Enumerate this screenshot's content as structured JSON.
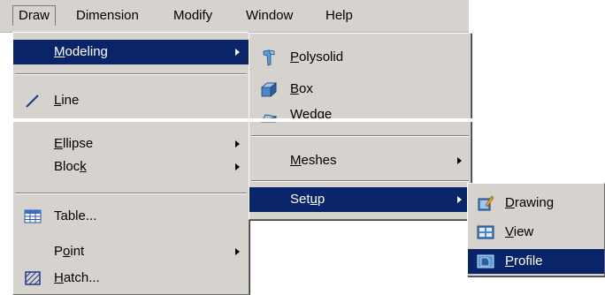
{
  "menubar": {
    "items": [
      "Draw",
      "Dimension",
      "Modify",
      "Window",
      "Help"
    ]
  },
  "draw_menu": {
    "modeling": {
      "pre": "",
      "acc": "M",
      "post": "odeling"
    },
    "line": {
      "pre": "",
      "acc": "L",
      "post": "ine"
    },
    "ellipse": {
      "pre": "",
      "acc": "E",
      "post": "llipse"
    },
    "block": {
      "pre": "Bloc",
      "acc": "k",
      "post": ""
    },
    "table": {
      "pre": "Table...",
      "acc": "",
      "post": ""
    },
    "point": {
      "pre": "P",
      "acc": "o",
      "post": "int"
    },
    "hatch": {
      "pre": "",
      "acc": "H",
      "post": "atch..."
    }
  },
  "modeling_menu": {
    "polysolid": {
      "pre": "",
      "acc": "P",
      "post": "olysolid"
    },
    "box": {
      "pre": "",
      "acc": "B",
      "post": "ox"
    },
    "wedge": {
      "pre": "Wedge",
      "acc": "",
      "post": ""
    },
    "meshes": {
      "pre": "",
      "acc": "M",
      "post": "eshes"
    },
    "setup": {
      "pre": "Set",
      "acc": "u",
      "post": "p"
    }
  },
  "setup_menu": {
    "drawing": {
      "pre": "",
      "acc": "D",
      "post": "rawing"
    },
    "view": {
      "pre": "",
      "acc": "V",
      "post": "iew"
    },
    "profile": {
      "pre": "",
      "acc": "P",
      "post": "rofile"
    }
  },
  "colors": {
    "menu_bg": "#d6d3ce",
    "highlight": "#0a246a",
    "highlight_text": "#ffffff"
  }
}
